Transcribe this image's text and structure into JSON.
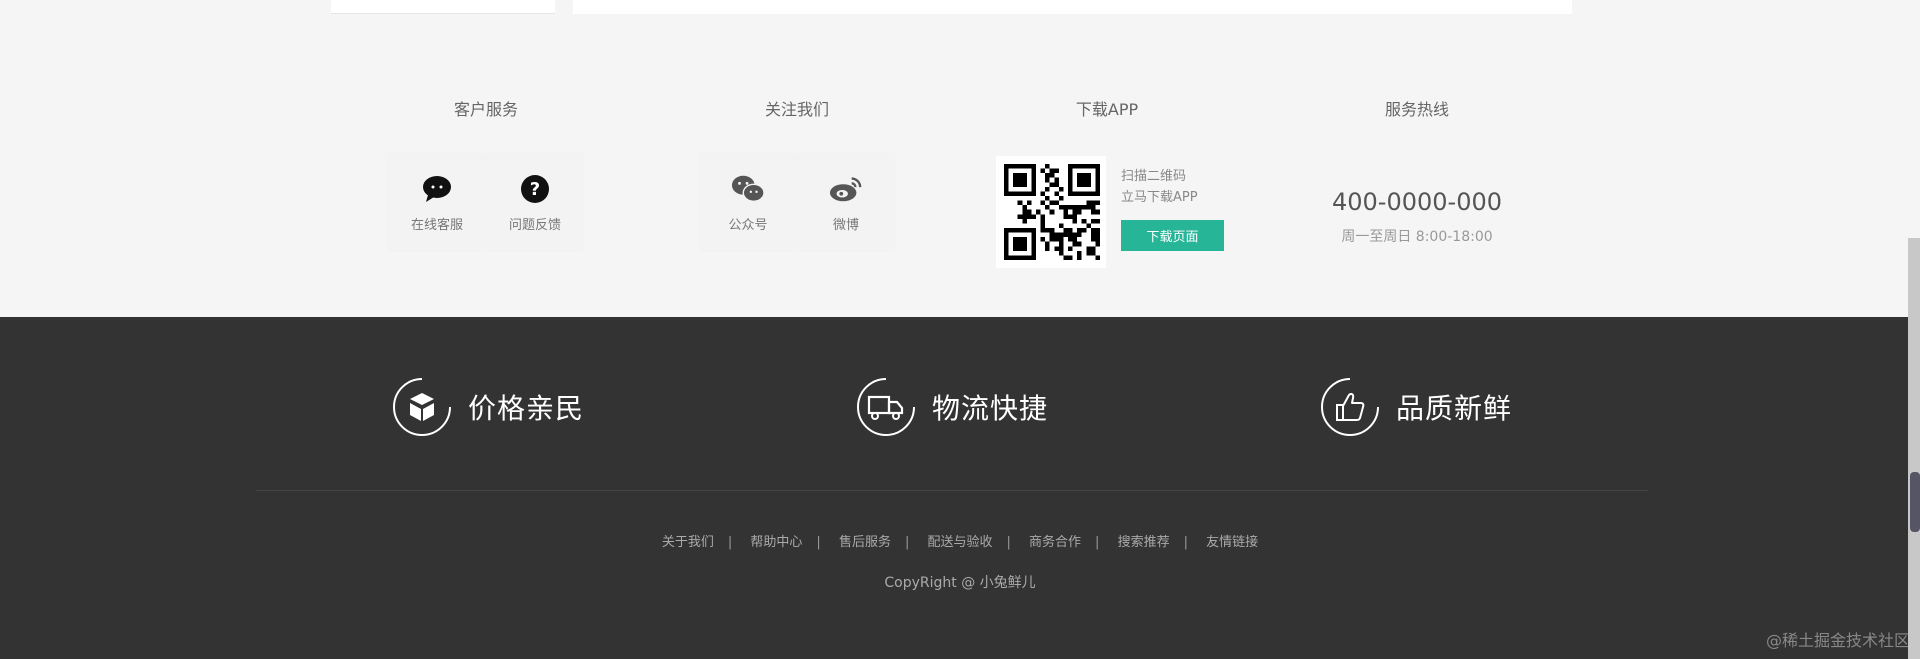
{
  "service": {
    "customer": {
      "title": "客户服务",
      "items": [
        {
          "label": "在线客服",
          "icon": "chat-bubble-icon"
        },
        {
          "label": "问题反馈",
          "icon": "question-icon"
        }
      ]
    },
    "follow": {
      "title": "关注我们",
      "items": [
        {
          "label": "公众号",
          "icon": "wechat-icon"
        },
        {
          "label": "微博",
          "icon": "weibo-icon"
        }
      ]
    },
    "app": {
      "title": "下载APP",
      "line1": "扫描二维码",
      "line2": "立马下载APP",
      "button": "下载页面"
    },
    "hotline": {
      "title": "服务热线",
      "number": "400-0000-000",
      "time": "周一至周日 8:00-18:00"
    }
  },
  "features": [
    {
      "label": "价格亲民",
      "icon": "price-box-icon"
    },
    {
      "label": "物流快捷",
      "icon": "truck-icon"
    },
    {
      "label": "品质新鲜",
      "icon": "thumbs-up-icon"
    }
  ],
  "links": [
    "关于我们",
    "帮助中心",
    "售后服务",
    "配送与验收",
    "商务合作",
    "搜索推荐",
    "友情链接"
  ],
  "separator": "|",
  "copyright": "CopyRight @ 小兔鲜儿",
  "watermark": "@稀土掘金技术社区",
  "colors": {
    "accent": "#27b597",
    "footer_bg": "#333333",
    "page_bg": "#f5f5f5"
  }
}
